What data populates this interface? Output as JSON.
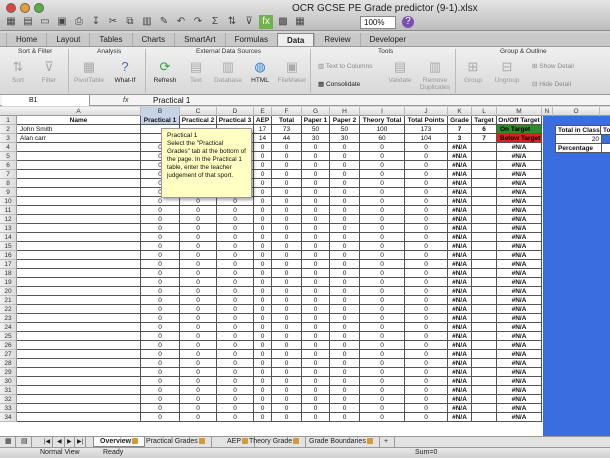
{
  "window": {
    "title": "OCR GCSE PE Grade predictor (9-1).xlsx"
  },
  "toolbar": {
    "zoom": "100%"
  },
  "ribbon": {
    "tabs": [
      "Home",
      "Layout",
      "Tables",
      "Charts",
      "SmartArt",
      "Formulas",
      "Data",
      "Review",
      "Developer"
    ],
    "active_tab": "Data",
    "groups": [
      "Sort & Filter",
      "Analysis",
      "External Data Sources",
      "Tools",
      "Group & Outline"
    ],
    "buttons": {
      "sort": "Sort",
      "filter": "Filter",
      "pivot": "PivotTable",
      "whatif": "What-If",
      "refresh": "Refresh",
      "text": "Text",
      "database": "Database",
      "html": "HTML",
      "filemaker": "FileMaker",
      "text_to_columns": "Text to Columns",
      "consolidate": "Consolidate",
      "validate": "Validate",
      "remove_duplicates": "Remove Duplicates",
      "group": "Group",
      "ungroup": "Ungroup",
      "show_detail": "Show Detail",
      "hide_detail": "Hide Detail"
    }
  },
  "formula": {
    "name_box": "B1",
    "fx": "fx",
    "value": "Practical 1"
  },
  "columns": [
    "A",
    "B",
    "C",
    "D",
    "E",
    "F",
    "G",
    "H",
    "I",
    "J",
    "K",
    "L",
    "M",
    "N",
    "O"
  ],
  "headers": [
    "Name",
    "Practical 1",
    "Practical 2",
    "Practical 3",
    "AEP",
    "Total",
    "Paper 1",
    "Paper 2",
    "Theory Total",
    "Total Points",
    "Grade",
    "Target",
    "On/Off Target"
  ],
  "students": [
    {
      "name": "John Smith",
      "p1": "",
      "p2": "",
      "p3": "",
      "aep": "17",
      "total": "73",
      "paper1": "50",
      "paper2": "50",
      "theory": "100",
      "points": "173",
      "grade": "7",
      "target": "6",
      "status": "On Target",
      "status_color": "#2e8b2e"
    },
    {
      "name": "Alan carr",
      "p1": "",
      "p2": "",
      "p3": "",
      "aep": "14",
      "total": "44",
      "paper1": "30",
      "paper2": "30",
      "theory": "60",
      "points": "104",
      "grade": "3",
      "target": "7",
      "status": "Below Target",
      "status_color": "#e02020"
    }
  ],
  "empty_row": {
    "p1": "0",
    "p2": "0",
    "p3": "0",
    "aep": "0",
    "total": "0",
    "paper1": "0",
    "paper2": "0",
    "theory": "0",
    "points": "0",
    "grade": "#N/A",
    "status": "#N/A"
  },
  "row_numbers": [
    "1",
    "2",
    "3",
    "4",
    "5",
    "6",
    "7",
    "8",
    "9",
    "10",
    "11",
    "12",
    "13",
    "14",
    "15",
    "16",
    "17",
    "18",
    "19",
    "20",
    "21",
    "22",
    "23",
    "24",
    "25",
    "26",
    "27",
    "28",
    "29",
    "30",
    "31",
    "32",
    "33",
    "34"
  ],
  "side_panel": {
    "total_in_class": "Total in Class",
    "total_value": "20",
    "to_label": "To",
    "percentage": "Percentage"
  },
  "tooltip": {
    "title": "Practical 1",
    "body": "Select the \"Practical Grades\" tab at the bottom of the page. In the Practical 1 table, enter the teacher judgement of that sport."
  },
  "sheet_tabs": [
    "Overview",
    "Practical Grades",
    "AEP",
    "Theory Grade",
    "Grade Boundaries",
    "+"
  ],
  "active_sheet": "Overview",
  "status": {
    "view": "Normal View",
    "ready": "Ready",
    "sum": "Sum=0"
  }
}
